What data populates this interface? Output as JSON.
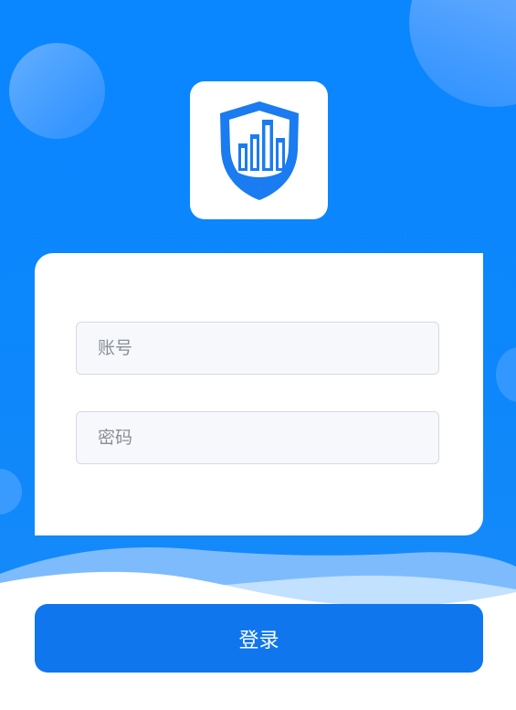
{
  "colors": {
    "background": "#0a86ff",
    "brand": "#1a7cf0",
    "card": "#ffffff",
    "button": "#0f76ee",
    "input_background": "#f7f8fc",
    "placeholder": "#8a8e96"
  },
  "logo": {
    "icon": "building-shield-icon"
  },
  "form": {
    "account_placeholder": "账号",
    "password_placeholder": "密码"
  },
  "actions": {
    "login_label": "登录"
  }
}
